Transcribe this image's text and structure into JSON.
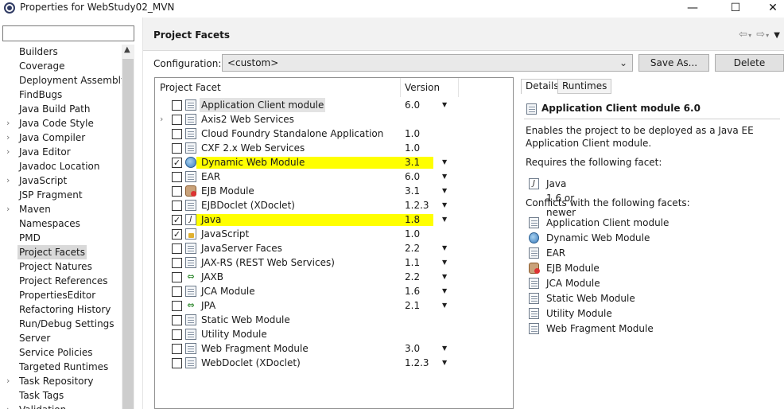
{
  "window": {
    "title": "Properties for WebStudy02_MVN",
    "min_glyph": "—",
    "max_glyph": "☐",
    "close_glyph": "✕"
  },
  "filter": {
    "value": ""
  },
  "nav": {
    "items": [
      {
        "label": "Builders",
        "expandable": false
      },
      {
        "label": "Coverage",
        "expandable": false
      },
      {
        "label": "Deployment Assembly",
        "expandable": false
      },
      {
        "label": "FindBugs",
        "expandable": false
      },
      {
        "label": "Java Build Path",
        "expandable": false
      },
      {
        "label": "Java Code Style",
        "expandable": true
      },
      {
        "label": "Java Compiler",
        "expandable": true
      },
      {
        "label": "Java Editor",
        "expandable": true
      },
      {
        "label": "Javadoc Location",
        "expandable": false
      },
      {
        "label": "JavaScript",
        "expandable": true
      },
      {
        "label": "JSP Fragment",
        "expandable": false
      },
      {
        "label": "Maven",
        "expandable": true
      },
      {
        "label": "Namespaces",
        "expandable": false
      },
      {
        "label": "PMD",
        "expandable": false
      },
      {
        "label": "Project Facets",
        "expandable": false,
        "selected": true
      },
      {
        "label": "Project Natures",
        "expandable": false
      },
      {
        "label": "Project References",
        "expandable": false
      },
      {
        "label": "PropertiesEditor",
        "expandable": false
      },
      {
        "label": "Refactoring History",
        "expandable": false
      },
      {
        "label": "Run/Debug Settings",
        "expandable": false
      },
      {
        "label": "Server",
        "expandable": false
      },
      {
        "label": "Service Policies",
        "expandable": false
      },
      {
        "label": "Targeted Runtimes",
        "expandable": false
      },
      {
        "label": "Task Repository",
        "expandable": true
      },
      {
        "label": "Task Tags",
        "expandable": false
      },
      {
        "label": "Validation",
        "expandable": true
      }
    ]
  },
  "page": {
    "title": "Project Facets",
    "config_label": "Configuration:",
    "config_value": "<custom>",
    "save_as": "Save As...",
    "delete": "Delete"
  },
  "facets": {
    "col_facet": "Project Facet",
    "col_version": "Version",
    "rows": [
      {
        "name": "Application Client module",
        "version": "6.0",
        "checked": false,
        "icon": "doc-icon",
        "dropdown": true,
        "selected": true
      },
      {
        "name": "Axis2 Web Services",
        "version": "",
        "checked": false,
        "icon": "doc-icon",
        "dropdown": false,
        "expandable": true
      },
      {
        "name": "Cloud Foundry Standalone Application",
        "version": "1.0",
        "checked": false,
        "icon": "doc-icon",
        "dropdown": false
      },
      {
        "name": "CXF 2.x Web Services",
        "version": "1.0",
        "checked": false,
        "icon": "doc-icon",
        "dropdown": false
      },
      {
        "name": "Dynamic Web Module",
        "version": "3.1",
        "checked": true,
        "icon": "globe-icon",
        "dropdown": true,
        "highlight": true
      },
      {
        "name": "EAR",
        "version": "6.0",
        "checked": false,
        "icon": "doc-icon",
        "dropdown": true
      },
      {
        "name": "EJB Module",
        "version": "3.1",
        "checked": false,
        "icon": "bean-icon",
        "dropdown": true
      },
      {
        "name": "EJBDoclet (XDoclet)",
        "version": "1.2.3",
        "checked": false,
        "icon": "doc-icon",
        "dropdown": true
      },
      {
        "name": "Java",
        "version": "1.8",
        "checked": true,
        "icon": "java-icon",
        "dropdown": true,
        "highlight": true
      },
      {
        "name": "JavaScript",
        "version": "1.0",
        "checked": true,
        "icon": "javascript-icon",
        "dropdown": false
      },
      {
        "name": "JavaServer Faces",
        "version": "2.2",
        "checked": false,
        "icon": "doc-icon",
        "dropdown": true
      },
      {
        "name": "JAX-RS (REST Web Services)",
        "version": "1.1",
        "checked": false,
        "icon": "doc-icon",
        "dropdown": true
      },
      {
        "name": "JAXB",
        "version": "2.2",
        "checked": false,
        "icon": "arrows-icon",
        "dropdown": true
      },
      {
        "name": "JCA Module",
        "version": "1.6",
        "checked": false,
        "icon": "doc-icon",
        "dropdown": true
      },
      {
        "name": "JPA",
        "version": "2.1",
        "checked": false,
        "icon": "arrows-icon",
        "dropdown": true
      },
      {
        "name": "Static Web Module",
        "version": "",
        "checked": false,
        "icon": "doc-icon",
        "dropdown": false
      },
      {
        "name": "Utility Module",
        "version": "",
        "checked": false,
        "icon": "doc-icon",
        "dropdown": false
      },
      {
        "name": "Web Fragment Module",
        "version": "3.0",
        "checked": false,
        "icon": "doc-icon",
        "dropdown": true
      },
      {
        "name": "WebDoclet (XDoclet)",
        "version": "1.2.3",
        "checked": false,
        "icon": "doc-icon",
        "dropdown": true
      }
    ]
  },
  "tabs": {
    "details": "Details",
    "runtimes": "Runtimes"
  },
  "details": {
    "title": "Application Client module 6.0",
    "description": "Enables the project to be deployed as a Java EE Application Client module.",
    "requires_label": "Requires the following facet:",
    "requires": [
      {
        "label": "Java 1.6 or newer",
        "icon": "java-icon"
      }
    ],
    "conflicts_label": "Conflicts with the following facets:",
    "conflicts": [
      {
        "label": "Application Client module",
        "icon": "doc-icon"
      },
      {
        "label": "Dynamic Web Module",
        "icon": "globe-icon"
      },
      {
        "label": "EAR",
        "icon": "doc-icon"
      },
      {
        "label": "EJB Module",
        "icon": "bean-icon"
      },
      {
        "label": "JCA Module",
        "icon": "doc-icon"
      },
      {
        "label": "Static Web Module",
        "icon": "doc-icon"
      },
      {
        "label": "Utility Module",
        "icon": "doc-icon"
      },
      {
        "label": "Web Fragment Module",
        "icon": "doc-icon"
      }
    ]
  },
  "colors": {
    "highlight": "#ffff00",
    "selection": "#d9d9d9",
    "header_bg": "#f2f2f2"
  }
}
